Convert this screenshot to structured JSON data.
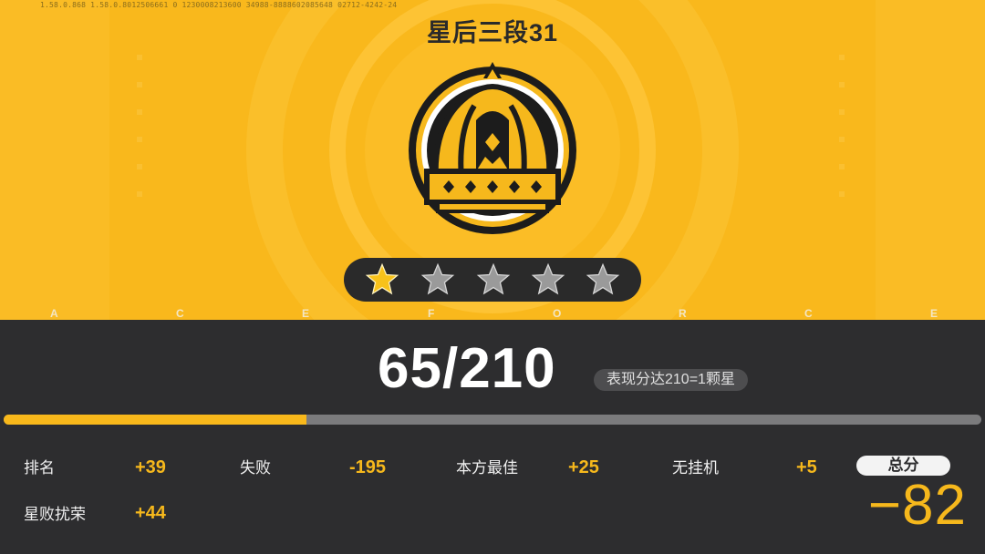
{
  "header": {
    "debug_text": "1.58.0.868  1.58.0.8012506661  0  1230008213600  34988-8888602085648  02712-4242-24",
    "rank_title": "星后三段31"
  },
  "emblem": {
    "icon": "crown-icon"
  },
  "stars": {
    "total": 5,
    "filled": 1,
    "filled_color": "#f8c21a",
    "empty_color": "#9a9a9a"
  },
  "watermark_letters": [
    "A",
    "C",
    "E",
    "F",
    "O",
    "R",
    "C",
    "E"
  ],
  "score": {
    "current": 65,
    "target": 210,
    "progress_text": "65/210",
    "hint": "表现分达210=1颗星",
    "progress_fraction": 0.31
  },
  "breakdown": {
    "items": [
      {
        "label": "排名",
        "value": "+39"
      },
      {
        "label": "失败",
        "value": "-195"
      },
      {
        "label": "本方最佳",
        "value": "+25"
      },
      {
        "label": "无挂机",
        "value": "+5"
      },
      {
        "label": "星败扰荣",
        "value": "+44"
      }
    ],
    "total_label": "总分",
    "total_value": "−82"
  },
  "colors": {
    "accent": "#f9b81c",
    "dark_panel": "#2d2d2f",
    "text_light": "#ffffff",
    "value_yellow": "#f6b81c"
  }
}
